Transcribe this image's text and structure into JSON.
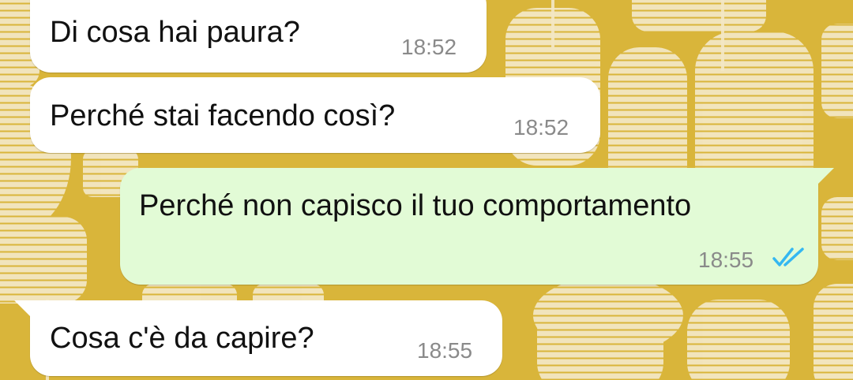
{
  "colors": {
    "wallpaper": "#d9b53a",
    "incoming_bubble": "#ffffff",
    "outgoing_bubble": "#e2fbd6",
    "time_text": "#8a8a8a",
    "read_ticks": "#34b7f1"
  },
  "messages": [
    {
      "direction": "incoming",
      "text": "Di cosa hai paura?",
      "time": "18:52"
    },
    {
      "direction": "incoming",
      "text": "Perché stai facendo così?",
      "time": "18:52"
    },
    {
      "direction": "outgoing",
      "text": "Perché non capisco il tuo comportamento",
      "time": "18:55",
      "status_icon": "double-check-read-icon"
    },
    {
      "direction": "incoming",
      "text": "Cosa c'è da capire?",
      "time": "18:55"
    }
  ]
}
